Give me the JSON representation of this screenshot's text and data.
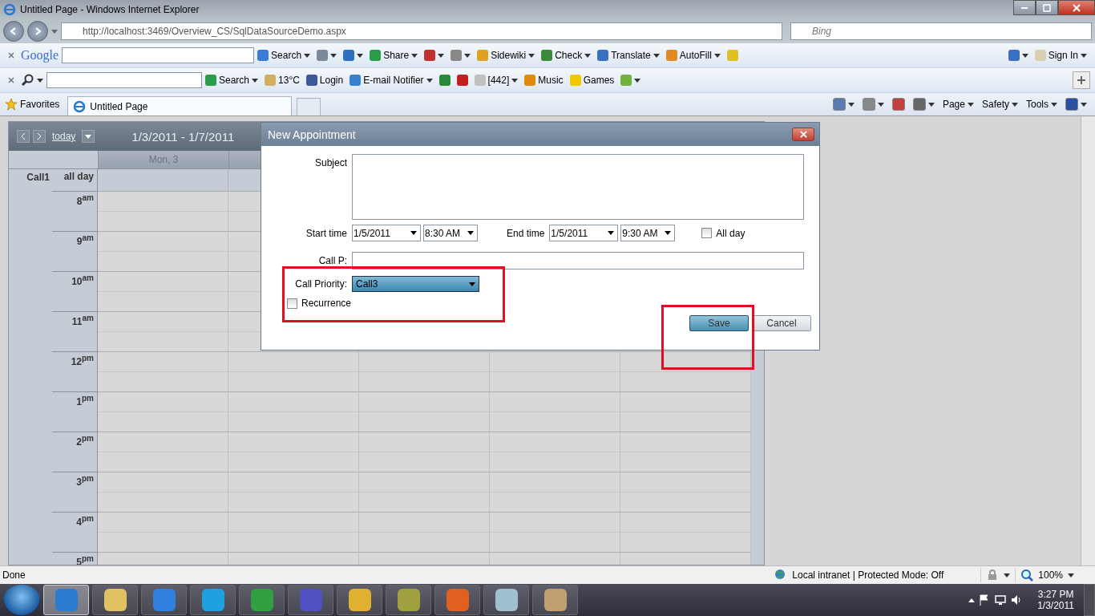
{
  "window": {
    "title": "Untitled Page - Windows Internet Explorer"
  },
  "address_bar": {
    "url": "http://localhost:3469/Overview_CS/SqlDataSourceDemo.aspx",
    "search_placeholder": "Bing"
  },
  "toolbar_1": {
    "logo": "Google",
    "items": [
      {
        "label": "Search",
        "dropdown": true
      },
      {
        "dropdown": true
      },
      {
        "dropdown": true
      },
      {
        "label": "Share",
        "dropdown": true
      },
      {
        "dropdown": true
      },
      {
        "dropdown": true
      },
      {
        "label": "Sidewiki",
        "dropdown": true
      },
      {
        "label": "Check",
        "dropdown": true
      },
      {
        "label": "Translate",
        "dropdown": true
      },
      {
        "label": "AutoFill",
        "dropdown": true
      },
      {
        "dropdown": false
      }
    ],
    "right_items": [
      {
        "dropdown": true
      },
      {
        "label": "Sign In",
        "dropdown": true
      }
    ]
  },
  "toolbar_2": {
    "items": [
      {
        "label": "Search",
        "dropdown": true
      },
      {
        "label": "13°C",
        "dropdown": false
      },
      {
        "label": "Login",
        "dropdown": false
      },
      {
        "label": "E-mail Notifier",
        "dropdown": true
      },
      {
        "dropdown": false
      },
      {
        "dropdown": false
      },
      {
        "label": "[442]",
        "dropdown": true
      },
      {
        "label": "Music",
        "dropdown": false
      },
      {
        "label": "Games",
        "dropdown": false
      },
      {
        "dropdown": true
      }
    ]
  },
  "command_bar": {
    "favorites": "Favorites",
    "tabs": [
      {
        "label": "Untitled Page",
        "selected": true
      }
    ],
    "items": [
      {
        "dropdown": true
      },
      {
        "dropdown": true
      },
      {
        "dropdown": false
      },
      {
        "dropdown": true
      },
      {
        "label": "Page",
        "dropdown": true
      },
      {
        "label": "Safety",
        "dropdown": true
      },
      {
        "label": "Tools",
        "dropdown": true
      },
      {
        "dropdown": true
      }
    ]
  },
  "calendar": {
    "today": "today",
    "range": "1/3/2011 - 1/7/2011",
    "day_headers": [
      "Mon, 3"
    ],
    "resource": "Call1",
    "all_day": "all day",
    "hours": [
      "8$^{am}$",
      "9$^{am}$",
      "10$^{am}$",
      "11$^{am}$",
      "12$^{pm}$",
      "1$^{pm}$",
      "2$^{pm}$",
      "3$^{pm}$",
      "4$^{pm}$",
      "5$^{pm}$"
    ]
  },
  "dialog": {
    "title": "New Appointment",
    "subject_label": "Subject",
    "start_label": "Start time",
    "start_date": "1/5/2011",
    "start_time": "8:30 AM",
    "end_label": "End time",
    "end_date": "1/5/2011",
    "end_time": "9:30 AM",
    "all_day": {
      "label": "All day",
      "checked": false
    },
    "call_p_label": "Call P:",
    "priority_label": "Call Priority:",
    "priority_value": "Call3",
    "recurrence": {
      "label": "Recurrence",
      "checked": false
    },
    "buttons": [
      {
        "label": "Save",
        "kind": "primary"
      },
      {
        "label": "Cancel",
        "kind": "normal"
      }
    ]
  },
  "status_bar": {
    "text": "Done",
    "zone": "Local intranet | Protected Mode: Off",
    "zoom": "100%"
  },
  "taskbar": {
    "buttons": [
      {
        "selected": true
      },
      {
        "selected": false
      },
      {
        "selected": false
      },
      {
        "selected": false
      },
      {
        "selected": false
      },
      {
        "selected": false
      },
      {
        "selected": false
      },
      {
        "selected": false
      },
      {
        "selected": false
      },
      {
        "selected": false
      },
      {
        "selected": false
      }
    ],
    "time": "3:27 PM",
    "date": "1/3/2011"
  }
}
